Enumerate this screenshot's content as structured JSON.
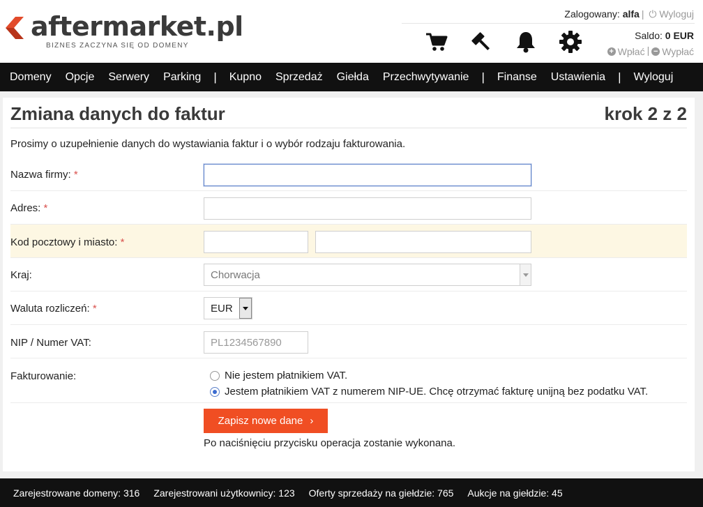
{
  "header": {
    "logo_text": "aftermarket.pl",
    "logo_tagline": "BIZNES ZACZYNA SIĘ OD DOMENY",
    "logged_in_label": "Zalogowany:",
    "username": "alfa",
    "logout_label": "Wyloguj",
    "saldo_label": "Saldo:",
    "saldo_value": "0 EUR",
    "deposit_label": "Wpłać",
    "withdraw_label": "Wypłać",
    "icons": [
      "cart-icon",
      "gavel-icon",
      "bell-icon",
      "gear-icon"
    ]
  },
  "nav": {
    "items": [
      "Domeny",
      "Opcje",
      "Serwery",
      "Parking",
      "|",
      "Kupno",
      "Sprzedaż",
      "Giełda",
      "Przechwytywanie",
      "|",
      "Finanse",
      "Ustawienia",
      "|",
      "Wyloguj"
    ]
  },
  "form": {
    "title": "Zmiana danych do faktur",
    "step": "krok 2 z 2",
    "intro": "Prosimy o uzupełnienie danych do wystawiania faktur i o wybór rodzaju fakturowania.",
    "required_mark": "*",
    "fields": {
      "company": {
        "label": "Nazwa firmy:",
        "value": ""
      },
      "address": {
        "label": "Adres:",
        "value": ""
      },
      "postal_city": {
        "label": "Kod pocztowy i miasto:",
        "postal_value": "",
        "city_value": ""
      },
      "country": {
        "label": "Kraj:",
        "value": "Chorwacja"
      },
      "currency": {
        "label": "Waluta rozliczeń:",
        "value": "EUR"
      },
      "vat_id": {
        "label": "NIP / Numer VAT:",
        "placeholder": "PL1234567890"
      },
      "invoicing": {
        "label": "Fakturowanie:",
        "options": [
          {
            "label": "Nie jestem płatnikiem VAT.",
            "selected": false
          },
          {
            "label": "Jestem płatnikiem VAT z numerem NIP-UE. Chcę otrzymać fakturę unijną bez podatku VAT.",
            "selected": true
          }
        ]
      }
    },
    "save_label": "Zapisz nowe dane",
    "save_note": "Po naciśnięciu przycisku operacja zostanie wykonana."
  },
  "footer": {
    "stats": [
      "Zarejestrowane domeny: 316",
      "Zarejestrowani użytkownicy: 123",
      "Oferty sprzedaży na giełdzie: 765",
      "Aukcje na giełdzie: 45"
    ]
  },
  "colors": {
    "accent": "#f04e23",
    "nav_bg": "#111111",
    "highlight_row": "#fdf7e3"
  }
}
